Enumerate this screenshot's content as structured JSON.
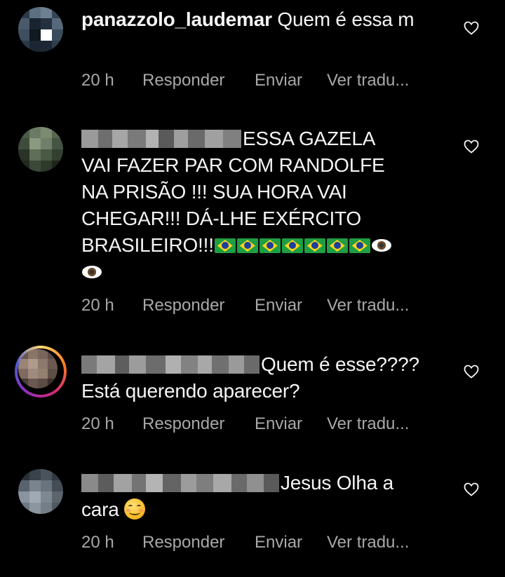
{
  "comments": [
    {
      "username": "panazzolo_laudemar",
      "text": "Quem é  essa m",
      "time": "20 h",
      "reply_label": "Responder",
      "send_label": "Enviar",
      "translate_label": "Ver tradu..."
    },
    {
      "username_blurred": true,
      "line1": "ESSA GAZELA",
      "line2": "VAI FAZER PAR COM RANDOLFE",
      "line3": "NA PRISÃO !!! SUA HORA  VAI",
      "line4": "CHEGAR!!! DÁ-LHE EXÉRCITO",
      "line5": "BRASILEIRO!!!",
      "emojis": [
        "brazil-flag",
        "brazil-flag",
        "brazil-flag",
        "brazil-flag",
        "brazil-flag",
        "brazil-flag",
        "brazil-flag",
        "eye",
        "eye"
      ],
      "time": "20 h",
      "reply_label": "Responder",
      "send_label": "Enviar",
      "translate_label": "Ver tradu..."
    },
    {
      "username_blurred": true,
      "line1": "Quem é esse????",
      "line2": "Está querendo aparecer?",
      "time": "20 h",
      "reply_label": "Responder",
      "send_label": "Enviar",
      "translate_label": "Ver tradu..."
    },
    {
      "username_blurred": true,
      "line1": "Jesus Olha  a",
      "line2": "cara",
      "emojis": [
        "smiling-face"
      ],
      "time": "20 h",
      "reply_label": "Responder",
      "send_label": "Enviar",
      "translate_label": "Ver tradu..."
    }
  ],
  "colors": {
    "background": "#000000",
    "text": "#f5f5f5",
    "meta": "#a8a8a8",
    "story_ring": [
      "#feda75",
      "#fa7e1e",
      "#d62976",
      "#962fbf",
      "#4f5bd5"
    ]
  }
}
